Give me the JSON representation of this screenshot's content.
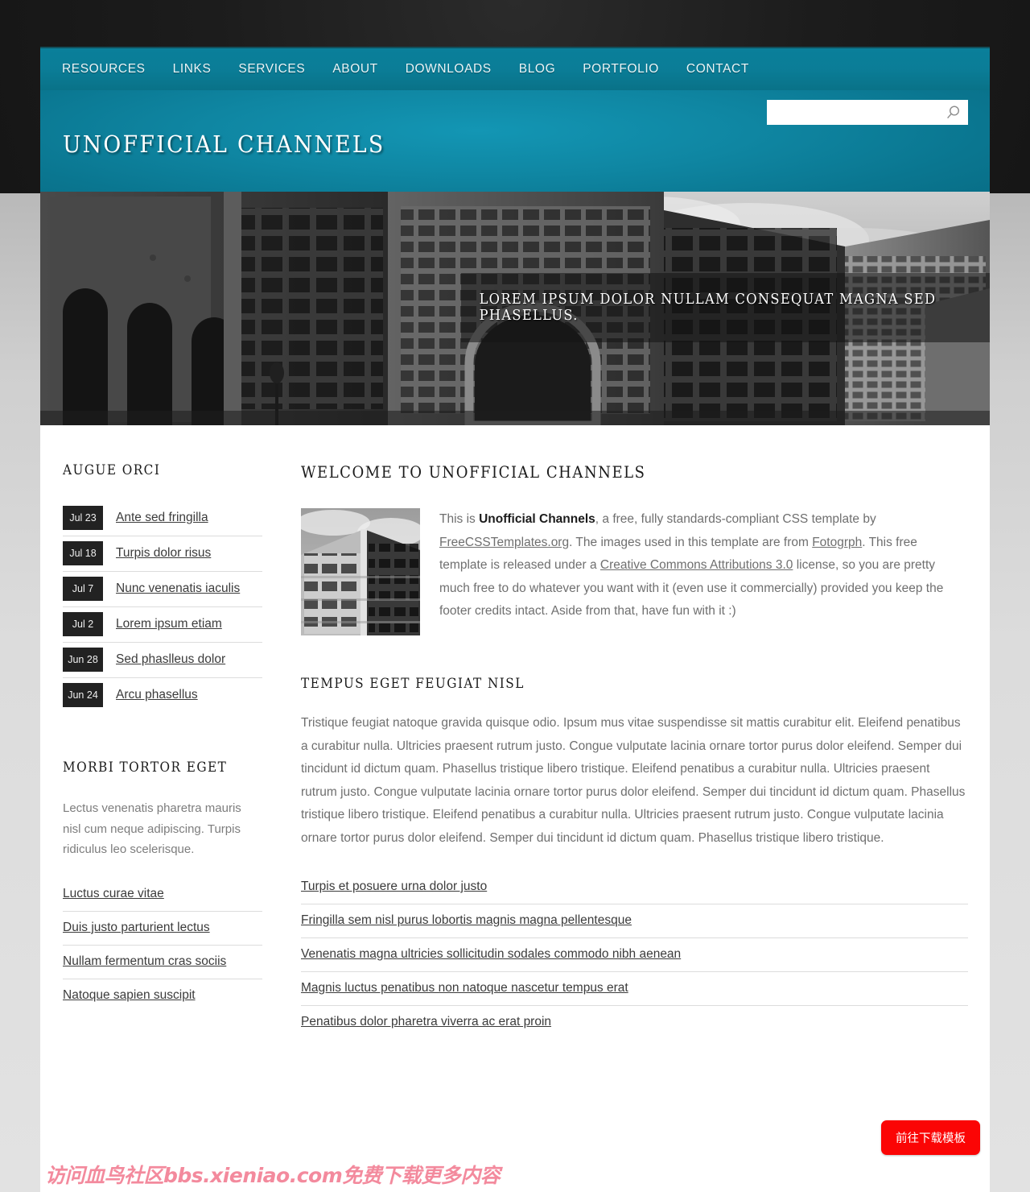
{
  "nav": {
    "items": [
      {
        "label": "RESOURCES"
      },
      {
        "label": "LINKS"
      },
      {
        "label": "SERVICES"
      },
      {
        "label": "ABOUT"
      },
      {
        "label": "DOWNLOADS"
      },
      {
        "label": "BLOG"
      },
      {
        "label": "PORTFOLIO"
      },
      {
        "label": "CONTACT"
      }
    ]
  },
  "search": {
    "value": "",
    "placeholder": "",
    "icon": "search-icon"
  },
  "header": {
    "logo": "UNOFFICIAL CHANNELS"
  },
  "banner": {
    "caption": "LOREM IPSUM DOLOR NULLAM CONSEQUAT MAGNA SED PHASELLUS."
  },
  "sidebar": {
    "augue": {
      "heading": "AUGUE ORCI",
      "entries": [
        {
          "date": "Jul 23",
          "title": "Ante sed fringilla"
        },
        {
          "date": "Jul 18",
          "title": "Turpis dolor risus"
        },
        {
          "date": "Jul 7",
          "title": "Nunc venenatis iaculis"
        },
        {
          "date": "Jul 2",
          "title": "Lorem ipsum etiam"
        },
        {
          "date": "Jun 28",
          "title": "Sed phaslleus dolor"
        },
        {
          "date": "Jun 24",
          "title": "Arcu phasellus"
        }
      ]
    },
    "morbi": {
      "heading": "MORBI TORTOR EGET",
      "paragraph": "Lectus venenatis pharetra mauris nisl cum neque adipiscing. Turpis ridiculus leo scelerisque.",
      "links": [
        "Luctus curae vitae",
        "Duis justo parturient lectus",
        "Nullam fermentum cras sociis",
        "Natoque sapien suscipit"
      ]
    }
  },
  "main": {
    "welcome_heading": "WELCOME TO UNOFFICIAL CHANNELS",
    "intro": {
      "p1a": "This is ",
      "brand": "Unofficial Channels",
      "p1b": ", a free, fully standards-compliant CSS template by ",
      "link1": "FreeCSSTemplates.org",
      "p1c": ". The images used in this template are from ",
      "link2": "Fotogrph",
      "p1d": ". This free template is released under a ",
      "link3": "Creative Commons Attributions 3.0",
      "p1e": " license, so you are pretty much free to do whatever you want with it (even use it commercially) provided you keep the footer credits intact. Aside from that, have fun with it :)"
    },
    "tempus_heading": "TEMPUS EGET FEUGIAT NISL",
    "body_paragraph": "Tristique feugiat natoque gravida quisque odio. Ipsum mus vitae suspendisse sit mattis curabitur elit. Eleifend penatibus a curabitur nulla. Ultricies praesent rutrum justo. Congue vulputate lacinia ornare tortor purus dolor eleifend. Semper dui tincidunt id dictum quam. Phasellus tristique libero tristique. Eleifend penatibus a curabitur nulla. Ultricies praesent rutrum justo. Congue vulputate lacinia ornare tortor purus dolor eleifend. Semper dui tincidunt id dictum quam. Phasellus tristique libero tristique. Eleifend penatibus a curabitur nulla. Ultricies praesent rutrum justo. Congue vulputate lacinia ornare tortor purus dolor eleifend. Semper dui tincidunt id dictum quam. Phasellus tristique libero tristique.",
    "links": [
      "Turpis et posuere urna dolor justo",
      "Fringilla sem nisl purus lobortis magnis magna pellentesque",
      "Venenatis magna ultricies sollicitudin sodales commodo nibh aenean",
      "Magnis luctus penatibus non natoque nascetur tempus erat",
      "Penatibus dolor pharetra viverra ac erat proin"
    ]
  },
  "overlay": {
    "download_button": "前往下载模板",
    "watermark": "访问血鸟社区bbs.xieniao.com免费下载更多内容"
  },
  "colors": {
    "accent_teal": "#0f86a2",
    "nav_teal": "#0a7f9a",
    "badge_dark": "#222222",
    "button_red": "#fb0505",
    "watermark_pink": "#f38a9d"
  }
}
